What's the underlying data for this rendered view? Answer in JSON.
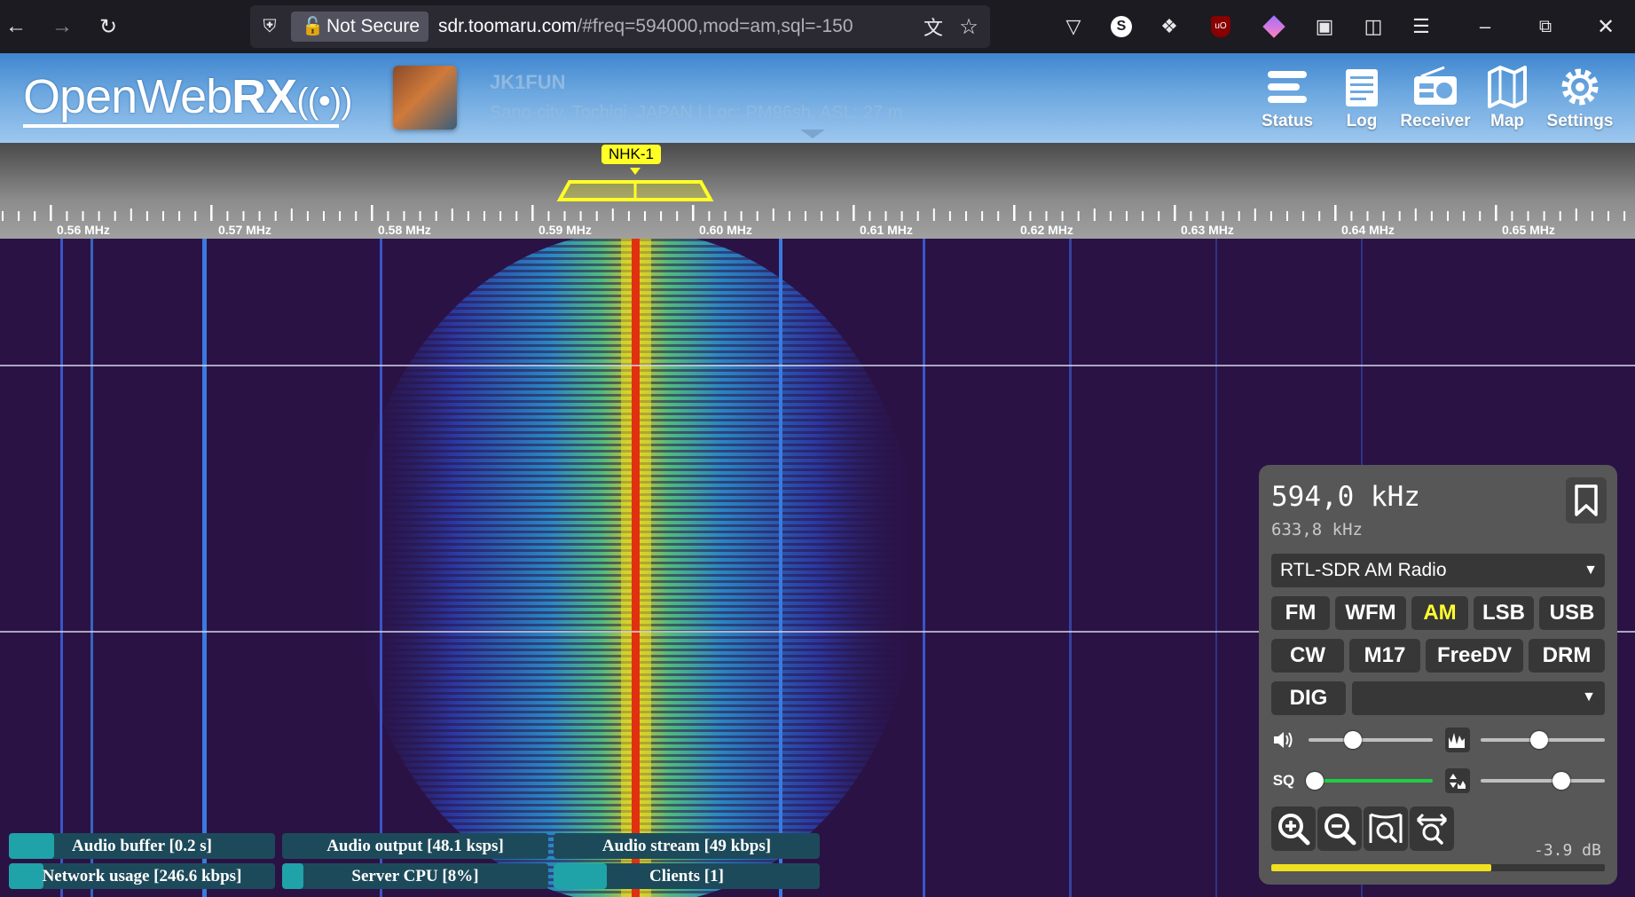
{
  "browser": {
    "not_secure": "Not Secure",
    "url_host": "sdr.toomaru.com",
    "url_rest": "/#freq=594000,mod=am,sql=-150"
  },
  "header": {
    "logo_part1": "Open",
    "logo_part2": "Web",
    "logo_part3": "RX",
    "receiver_name": "JK1FUN",
    "receiver_location": "Sano-city, Tochigi, JAPAN | Loc: PM96sh, ASL: 27 m",
    "nav": [
      {
        "label": "Status",
        "icon": "status-icon"
      },
      {
        "label": "Log",
        "icon": "log-icon"
      },
      {
        "label": "Receiver",
        "icon": "receiver-icon"
      },
      {
        "label": "Map",
        "icon": "map-icon"
      },
      {
        "label": "Settings",
        "icon": "gear-icon"
      }
    ]
  },
  "scale": {
    "bookmark_tag": "NHK-1",
    "labels": [
      "0.56 MHz",
      "0.57 MHz",
      "0.58 MHz",
      "0.59 MHz",
      "0.60 MHz",
      "0.61 MHz",
      "0.62 MHz",
      "0.63 MHz",
      "0.64 MHz",
      "0.65 MHz"
    ]
  },
  "panel": {
    "frequency": "594,0 kHz",
    "offset_frequency": "633,8 kHz",
    "profile": "RTL-SDR AM Radio",
    "modes_row1": [
      "FM",
      "WFM",
      "AM",
      "LSB",
      "USB"
    ],
    "modes_row2": [
      "CW",
      "M17",
      "FreeDV",
      "DRM"
    ],
    "dig_label": "DIG",
    "selected_mode": "AM",
    "volume_level": 0.36,
    "nr_level": 0.47,
    "squelch_level": 0.05,
    "gain_level": 0.65,
    "sq_label": "SQ",
    "db_value": "-3.9 dB",
    "smeter_level": 0.66,
    "accent_color": "#ffff30"
  },
  "status_bars": [
    {
      "label": "Audio buffer [0.2 s]",
      "level": 0.17
    },
    {
      "label": "Audio output [48.1 ksps]",
      "level": 0.0
    },
    {
      "label": "Audio stream [49 kbps]",
      "level": 0.0
    },
    {
      "label": "Network usage [246.6 kbps]",
      "level": 0.13
    },
    {
      "label": "Server CPU [8%]",
      "level": 0.08
    },
    {
      "label": "Clients [1]",
      "level": 0.2
    }
  ]
}
